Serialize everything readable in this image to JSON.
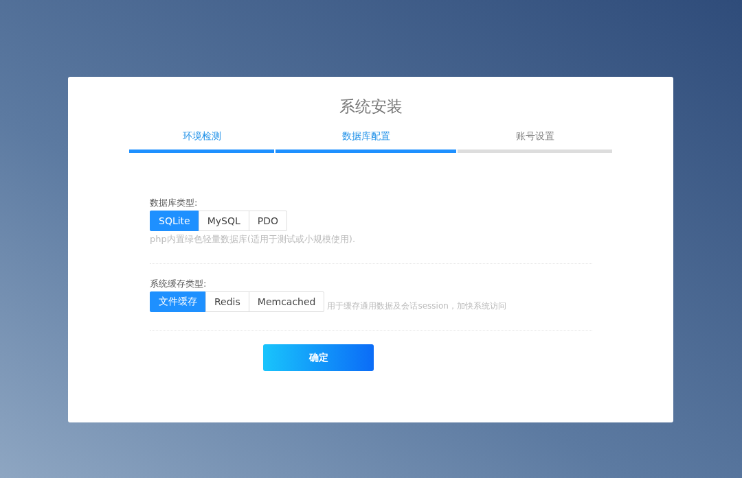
{
  "title": "系统安装",
  "steps": [
    {
      "label": "环境检测",
      "active": true
    },
    {
      "label": "数据库配置",
      "active": true
    },
    {
      "label": "账号设置",
      "active": false
    }
  ],
  "sections": [
    {
      "label": "数据库类型:",
      "options": [
        {
          "label": "SQLite",
          "selected": true
        },
        {
          "label": "MySQL",
          "selected": false
        },
        {
          "label": "PDO",
          "selected": false
        }
      ],
      "hint": "php内置绿色轻量数据库(适用于测试或小规模使用).",
      "hint_inline": false
    },
    {
      "label": "系统缓存类型:",
      "options": [
        {
          "label": "文件缓存",
          "selected": true
        },
        {
          "label": "Redis",
          "selected": false
        },
        {
          "label": "Memcached",
          "selected": false
        }
      ],
      "hint": "用于缓存通用数据及会话session，加快系统访问",
      "hint_inline": true
    }
  ],
  "submit": "确定"
}
